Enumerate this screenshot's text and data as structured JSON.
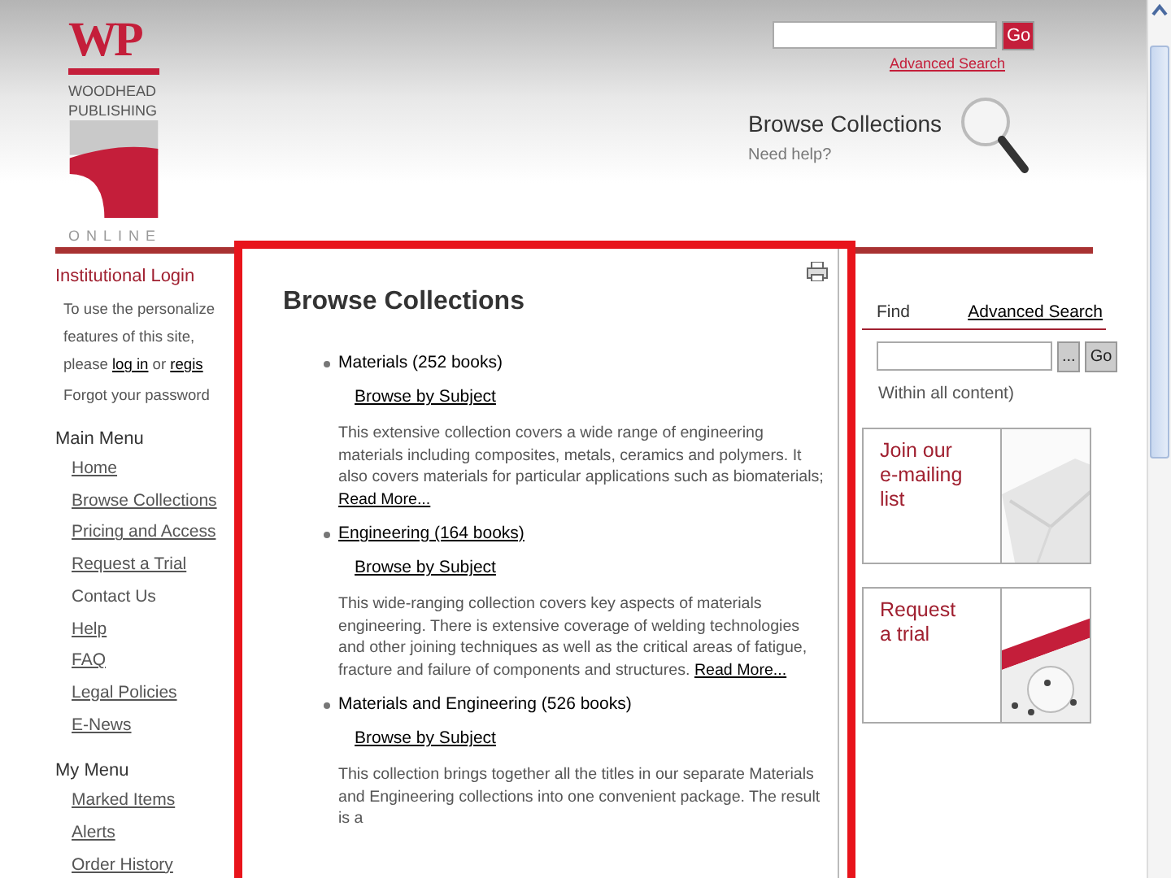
{
  "header": {
    "logo": {
      "letters": "WP",
      "line1": "WOODHEAD",
      "line2": "PUBLISHING",
      "line3": "ONLINE"
    },
    "search": {
      "button": "Go",
      "link": "Advanced Search"
    },
    "section_title": "Browse Collections",
    "help": "Need help?"
  },
  "login": {
    "title": "Institutional Login",
    "lines": [
      [
        {
          "text": "To use the personalize",
          "kind": "text"
        }
      ],
      [
        {
          "text": "features of this site,",
          "kind": "text"
        }
      ],
      [
        {
          "text": "please ",
          "kind": "text"
        },
        {
          "text": "log in",
          "kind": "link"
        },
        {
          "text": " or ",
          "kind": "text"
        },
        {
          "text": "regis",
          "kind": "link"
        }
      ],
      [
        {
          "text": "Forgot your password",
          "kind": "text"
        }
      ]
    ]
  },
  "main_menu": {
    "title": "Main Menu",
    "items": [
      {
        "label": "Home",
        "kind": "link"
      },
      {
        "label": "Browse Collections",
        "kind": "link"
      },
      {
        "label": "Pricing and Access",
        "kind": "link"
      },
      {
        "label": "Request a Trial",
        "kind": "link"
      },
      {
        "label": "Contact Us",
        "kind": "text"
      },
      {
        "label": "Help",
        "kind": "link"
      },
      {
        "label": "FAQ",
        "kind": "link"
      },
      {
        "label": "Legal Policies",
        "kind": "link"
      },
      {
        "label": "E-News",
        "kind": "link"
      }
    ]
  },
  "my_menu": {
    "title": "My Menu",
    "items": [
      {
        "label": "Marked Items",
        "kind": "link"
      },
      {
        "label": "Alerts",
        "kind": "link"
      },
      {
        "label": "Order History",
        "kind": "link"
      }
    ]
  },
  "right": {
    "find": "Find",
    "advanced": "Advanced Search",
    "browse_button": "...",
    "go_button": "Go",
    "scope": "Within all content)",
    "promos": [
      {
        "text": "Join our e-mailing list",
        "kind": "envelope"
      },
      {
        "text": "Request a trial",
        "kind": "calendar"
      }
    ]
  },
  "popup": {
    "title": "Browse Collections",
    "collections": [
      {
        "name": "Materials (252 books)",
        "kind": "text",
        "subject_link": "Browse by Subject",
        "description": "This extensive collection covers a wide range of engineering materials including composites, metals, ceramics and polymers. It also covers materials for particular applications such as biomaterials;",
        "read_more": "Read More..."
      },
      {
        "name": "Engineering (164 books)",
        "kind": "link",
        "subject_link": "Browse by Subject",
        "description": "This wide-ranging collection covers key aspects of materials engineering. There is extensive coverage of welding technologies and other joining techniques as well as the critical areas of fatigue, fracture and failure of components and structures.",
        "read_more": "Read More..."
      },
      {
        "name": "Materials and Engineering (526 books)",
        "kind": "text",
        "subject_link": "Browse by Subject",
        "description": "This collection brings together all the titles in our separate Materials and Engineering collections into one convenient package. The result is a"
      }
    ]
  }
}
